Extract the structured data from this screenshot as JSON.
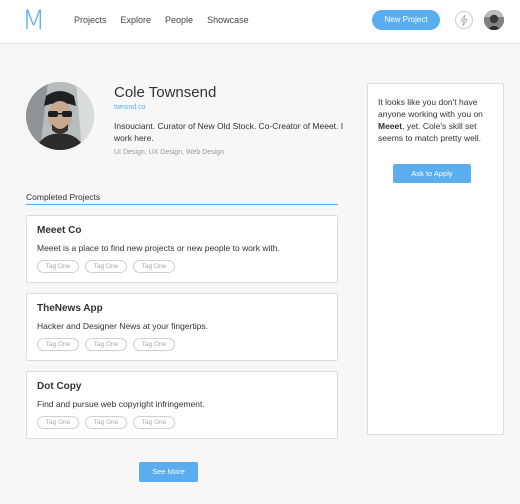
{
  "header": {
    "logo": "M",
    "nav": [
      "Projects",
      "Explore",
      "People",
      "Showcase"
    ],
    "new_project_label": "New Project"
  },
  "profile": {
    "name": "Cole Townsend",
    "link": "twnsnd.co",
    "bio": "Insouciant. Curator of New Old Stock. Co-Creator of Meeet. I work here.",
    "skills": "UI Design, UX Design, Web Design"
  },
  "completed": {
    "title": "Completed Projects",
    "projects": [
      {
        "title": "Meeet Co",
        "desc": "Meeet is a place to find new projects or new people to work with.",
        "tags": [
          "Tag One",
          "Tag One",
          "Tag One"
        ]
      },
      {
        "title": "TheNews App",
        "desc": "Hacker and Designer News at your fingertips.",
        "tags": [
          "Tag One",
          "Tag One",
          "Tag One"
        ]
      },
      {
        "title": "Dot Copy",
        "desc": "Find and pursue web copyright infringement.",
        "tags": [
          "Tag One",
          "Tag One",
          "Tag One"
        ]
      }
    ],
    "see_more_label": "See More"
  },
  "side": {
    "text_before": "It looks like you don't have anyone working with you on ",
    "text_bold": "Meeet",
    "text_after": ", yet. Cole's skill set seems to match pretty well.",
    "ask_label": "Ask to Apply"
  },
  "colors": {
    "accent": "#5aaef0"
  },
  "icons": {
    "activity": "bolt-icon"
  }
}
